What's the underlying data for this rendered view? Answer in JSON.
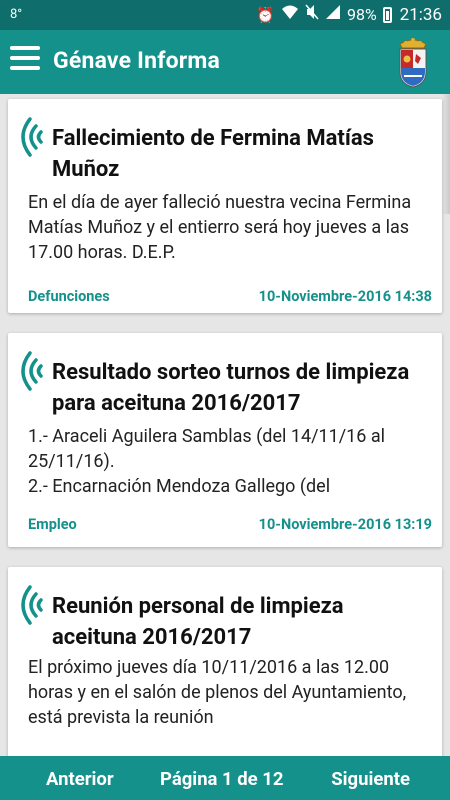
{
  "status_bar": {
    "temperature": "8°",
    "battery": "98%",
    "time": "21:36"
  },
  "app": {
    "title": "Génave Informa"
  },
  "cards": [
    {
      "title": "Fallecimiento de Fermina Matías Muñoz",
      "body": "En el día de ayer falleció nuestra vecina Fermina Matías Muñoz y el entierro será hoy jueves a las 17.00 horas. D.E.P.",
      "category": "Defunciones",
      "date": "10-Noviembre-2016 14:38"
    },
    {
      "title": "Resultado sorteo turnos de limpieza para aceituna 2016/2017",
      "body": "1.- Araceli Aguilera Samblas (del 14/11/16 al 25/11/16).\n2.- Encarnación Mendoza Gallego (del",
      "category": "Empleo",
      "date": "10-Noviembre-2016 13:19"
    },
    {
      "title": "Reunión personal de limpieza aceituna 2016/2017",
      "body": "El próximo jueves día 10/11/2016 a las 12.00 horas y en el salón de plenos del Ayuntamiento, está prevista la reunión",
      "category": "",
      "date": ""
    }
  ],
  "pagination": {
    "prev_label": "Anterior",
    "page_label": "Página 1 de 12",
    "next_label": "Siguiente"
  },
  "colors": {
    "status_bar": "#0f6e6c",
    "app_bar": "#15918b",
    "accent": "#15918b",
    "background": "#e6e6e6"
  }
}
